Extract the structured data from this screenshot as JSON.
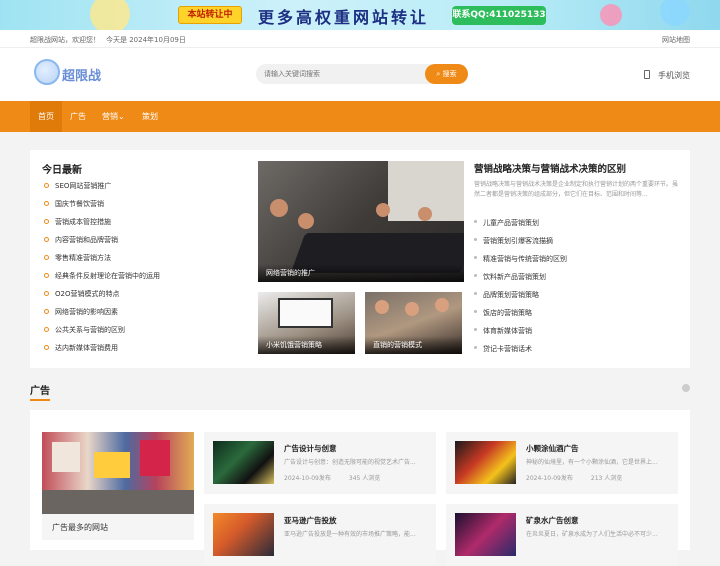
{
  "banner": {
    "badge": "本站转让中",
    "slogan": "更多高权重网站转让",
    "contact": "联系QQ:411025133"
  },
  "topbar": {
    "welcome": "超限战网站，欢迎您！",
    "date": "今天是 2024年10月09日",
    "sitemap": "网站地图"
  },
  "header": {
    "logo_text": "超限战",
    "search_placeholder": "请输入关键词搜索",
    "search_button": "搜索",
    "mobile_label": "手机浏览"
  },
  "nav": {
    "items": [
      {
        "label": "首页"
      },
      {
        "label": "广告"
      },
      {
        "label": "营销⌄"
      },
      {
        "label": "策划"
      }
    ]
  },
  "latest": {
    "title": "今日最新",
    "items": [
      "SEO网站营销推广",
      "国庆节餐饮营销",
      "营销成本管控措施",
      "内容营销和品牌营销",
      "零售精准营销方法",
      "经典条件反射理论在营销中的运用",
      "O2O营销模式的特点",
      "网络营销的影响因素",
      "公共关系与营销的区别",
      "达内新媒体营销费用"
    ]
  },
  "featured_images": {
    "big_caption": "网络营销的推广",
    "small1_caption": "小米饥饿营销策略",
    "small2_caption": "直销的营销模式"
  },
  "article": {
    "title": "营销战略决策与营销战术决策的区别",
    "summary": "营销战略决策与营销战术决策是企业制定和执行营销计划的两个重要环节。虽然二者都是营销决策的组成部分，但它们在目标、范围和时间等...",
    "list": [
      "儿童产品营销策划",
      "营销策划引爆客流描摘",
      "精准营销与传统营销的区别",
      "饮料新产品营销策划",
      "品牌策划营销策略",
      "饭店的营销策略",
      "体育新媒体营销",
      "贷记卡营销话术"
    ]
  },
  "ads_section": {
    "title": "广告",
    "feature_label": "广告最多的网站",
    "cards": [
      {
        "title": "广告设计与创意",
        "desc": "广告设计与创意：创造无限可能的视觉艺术广告...",
        "date": "2024-10-09发布",
        "views": "345 人浏览"
      },
      {
        "title": "小颗涂仙酒广告",
        "desc": "神秘的仙境里，有一个小颗涂仙酒，它是世界上...",
        "date": "2024-10-09发布",
        "views": "213 人浏览"
      },
      {
        "title": "亚马逊广告投放",
        "desc": "亚马逊广告投放是一种有效的市场推广策略，能...",
        "date": "",
        "views": ""
      },
      {
        "title": "矿泉水广告创意",
        "desc": "在炎炎夏日，矿泉水成为了人们生活中必不可少...",
        "date": "",
        "views": ""
      }
    ]
  },
  "colors": {
    "accent": "#f08a16",
    "contact_green": "#2ebd5d",
    "slogan_blue": "#1c2f82"
  }
}
